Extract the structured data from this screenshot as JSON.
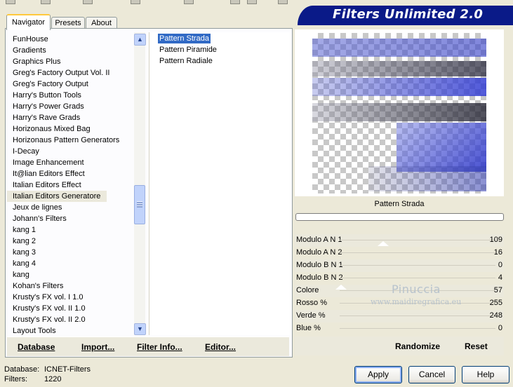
{
  "app": {
    "title": "Filters Unlimited 2.0"
  },
  "tabs": [
    {
      "label": "Navigator",
      "active": true
    },
    {
      "label": "Presets",
      "active": false
    },
    {
      "label": "About",
      "active": false
    }
  ],
  "categories": [
    "FunHouse",
    "Gradients",
    "Graphics Plus",
    "Greg's Factory Output Vol. II",
    "Greg's Factory Output",
    "Harry's Button Tools",
    "Harry's Power Grads",
    "Harry's Rave Grads",
    "Horizonaus Mixed Bag",
    "Horizonaus Pattern Generators",
    "I-Decay",
    "Image Enhancement",
    "It@lian Editors Effect",
    "Italian Editors Effect",
    "Italian Editors Generatore",
    "Jeux de lignes",
    "Johann's Filters",
    "kang 1",
    "kang 2",
    "kang 3",
    "kang 4",
    "kang",
    "Kohan's Filters",
    "Krusty's FX vol. I 1.0",
    "Krusty's FX vol. II 1.0",
    "Krusty's FX vol. II 2.0",
    "Layout Tools"
  ],
  "selected_category_index": 14,
  "filters": [
    "Pattern  Strada",
    "Pattern Piramide",
    "Pattern Radiale"
  ],
  "selected_filter_index": 0,
  "panel_buttons": {
    "database": "Database",
    "import": "Import...",
    "filter_info": "Filter Info...",
    "editor": "Editor..."
  },
  "preview": {
    "filter_name": "Pattern  Strada"
  },
  "params": [
    {
      "label": "Modulo A N 1",
      "value": "109"
    },
    {
      "label": "Modulo A N 2",
      "value": "16"
    },
    {
      "label": "Modulo B N 1",
      "value": "0"
    },
    {
      "label": "Modulo B N 2",
      "value": "4"
    },
    {
      "label": "Colore",
      "value": "57"
    },
    {
      "label": "Rosso %",
      "value": "255"
    },
    {
      "label": "Verde %",
      "value": "248"
    },
    {
      "label": "Blue %",
      "value": "0"
    }
  ],
  "watermark": {
    "name": "Pinuccia",
    "url": "www.maidiregrafica.eu"
  },
  "right_buttons": {
    "randomize": "Randomize",
    "reset": "Reset"
  },
  "footer": {
    "database_label": "Database:",
    "database_value": "ICNET-Filters",
    "filters_label": "Filters:",
    "filters_value": "1220"
  },
  "dialog_buttons": {
    "apply": "Apply",
    "cancel": "Cancel",
    "help": "Help"
  },
  "colors": {
    "banner": "#0a1a88",
    "selection": "#316ac5",
    "preview_band": "#3b46c8"
  }
}
